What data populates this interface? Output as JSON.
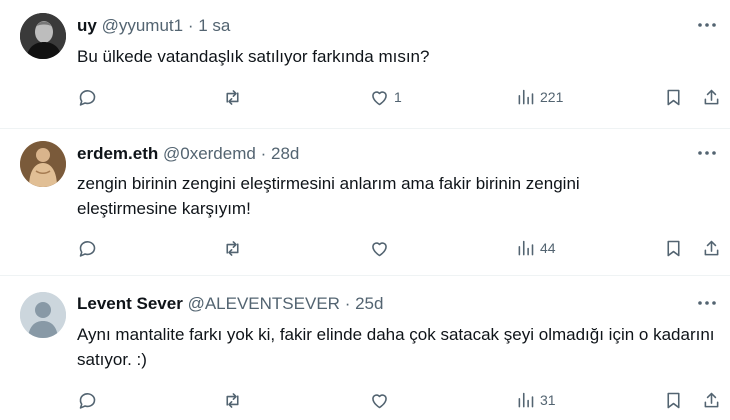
{
  "tweets": [
    {
      "name": "uy",
      "handle": "@yyumut1",
      "dot": "·",
      "time": "1 sa",
      "text": "Bu ülkede vatandaşlık satılıyor farkında mısın?",
      "likes": "1",
      "views": "221",
      "avatar": "photo-portrait-icon"
    },
    {
      "name": "erdem.eth",
      "handle": "@0xerdemd",
      "dot": "·",
      "time": "28d",
      "text": "zengin birinin zengini eleştirmesini anlarım ama fakir birinin zengini eleştirmesine karşıyım!",
      "likes": "",
      "views": "44",
      "avatar": "statue-portrait-icon"
    },
    {
      "name": "Levent Sever",
      "handle": "@ALEVENTSEVER",
      "dot": "·",
      "time": "25d",
      "text": "Aynı mantalite farkı yok ki, fakir elinde daha çok satacak şeyi olmadığı için o kadarını satıyor. :)",
      "likes": "",
      "views": "31",
      "avatar": "default-avatar-icon"
    }
  ],
  "colors": {
    "text": "#0f1419",
    "muted": "#536471",
    "divider": "#eff3f4",
    "default_avatar": "#ccd6dd"
  }
}
